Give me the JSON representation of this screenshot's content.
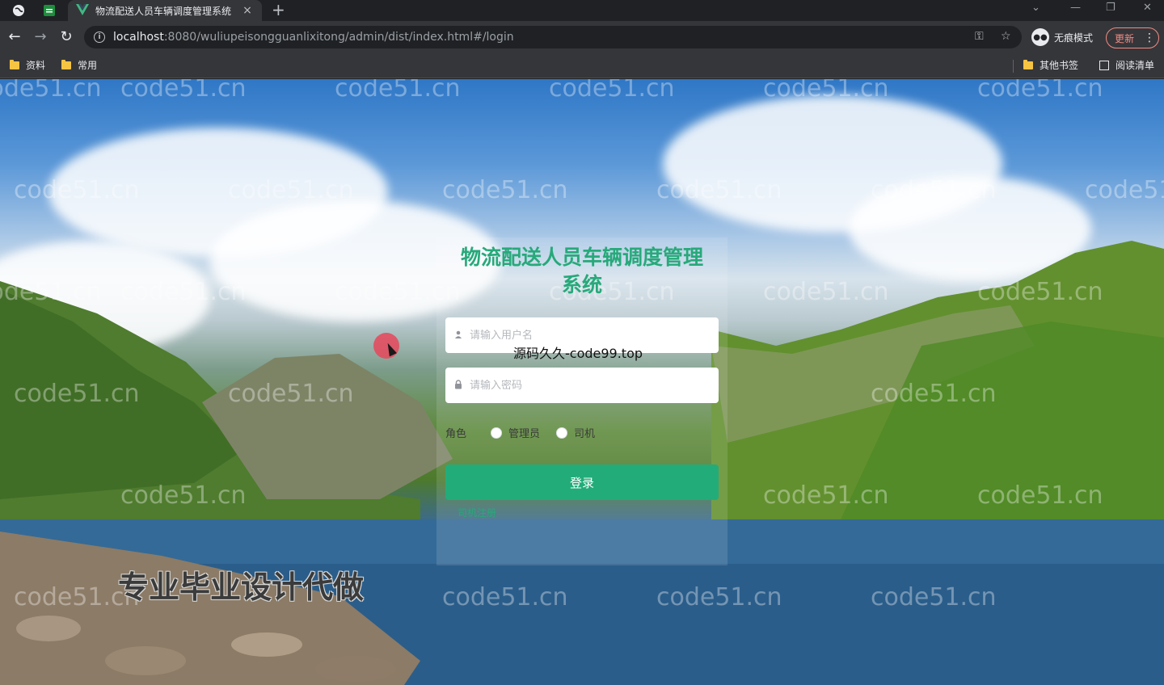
{
  "browser": {
    "tab_title": "物流配送人员车辆调度管理系统",
    "tab_close": "×",
    "new_tab": "+",
    "url_host": "localhost",
    "url_rest": ":8080/wuliupeisongguanlixitong/admin/dist/index.html#/login",
    "incognito_label": "无痕模式",
    "update_label": "更新",
    "bookmarks": [
      "资料",
      "常用"
    ],
    "other_bookmarks": "其他书签",
    "reading_list": "阅读清单"
  },
  "page": {
    "watermark_text": "code51.cn",
    "login": {
      "title": "物流配送人员车辆调度管理系统",
      "username_placeholder": "请输入用户名",
      "password_placeholder": "请输入密码",
      "role_label": "角色",
      "roles": [
        "管理员",
        "司机"
      ],
      "login_button": "登录",
      "register_link": "司机注册"
    },
    "overlay_text": "源码久久-code99.top",
    "promo_text": "专业毕业设计代做"
  }
}
